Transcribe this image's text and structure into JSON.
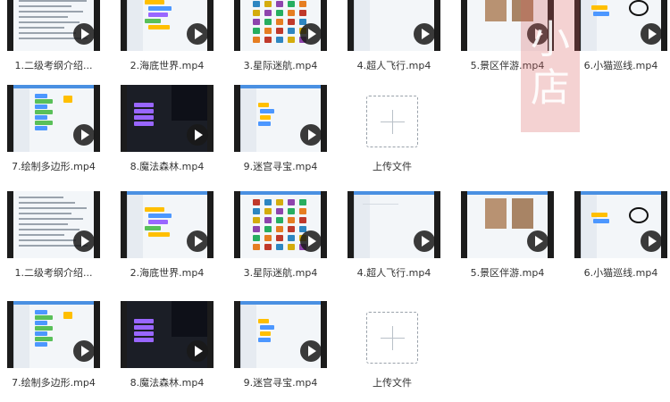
{
  "rows": [
    {
      "items": [
        {
          "name": "1.二级考纲介绍...",
          "kind": "doc"
        },
        {
          "name": "2.海底世界.mp4",
          "kind": "code"
        },
        {
          "name": "3.星际迷航.mp4",
          "kind": "sprites"
        },
        {
          "name": "4.超人飞行.mp4",
          "kind": "blank"
        },
        {
          "name": "5.景区伴游.mp4",
          "kind": "photo"
        },
        {
          "name": "6.小猫巡线.mp4",
          "kind": "cat"
        }
      ]
    },
    {
      "items": [
        {
          "name": "7.绘制多边形.mp4",
          "kind": "polygon"
        },
        {
          "name": "8.魔法森林.mp4",
          "kind": "magic"
        },
        {
          "name": "9.迷宫寻宝.mp4",
          "kind": "maze"
        }
      ],
      "upload": "上传文件"
    },
    {
      "items": [
        {
          "name": "1.二级考纲介绍...",
          "kind": "doc"
        },
        {
          "name": "2.海底世界.mp4",
          "kind": "code"
        },
        {
          "name": "3.星际迷航.mp4",
          "kind": "sprites"
        },
        {
          "name": "4.超人飞行.mp4",
          "kind": "blank"
        },
        {
          "name": "5.景区伴游.mp4",
          "kind": "photo"
        },
        {
          "name": "6.小猫巡线.mp4",
          "kind": "cat"
        }
      ]
    },
    {
      "items": [
        {
          "name": "7.绘制多边形.mp4",
          "kind": "polygon"
        },
        {
          "name": "8.魔法森林.mp4",
          "kind": "magic"
        },
        {
          "name": "9.迷宫寻宝.mp4",
          "kind": "maze"
        }
      ],
      "upload": "上传文件"
    }
  ],
  "watermark": {
    "text": "小店"
  },
  "colors": {
    "play_bg": "#191919",
    "accent": "#4a90e2",
    "block_blue": "#4c97ff",
    "block_purple": "#9966ff",
    "block_yellow": "#ffbf00",
    "block_green": "#59c059"
  }
}
